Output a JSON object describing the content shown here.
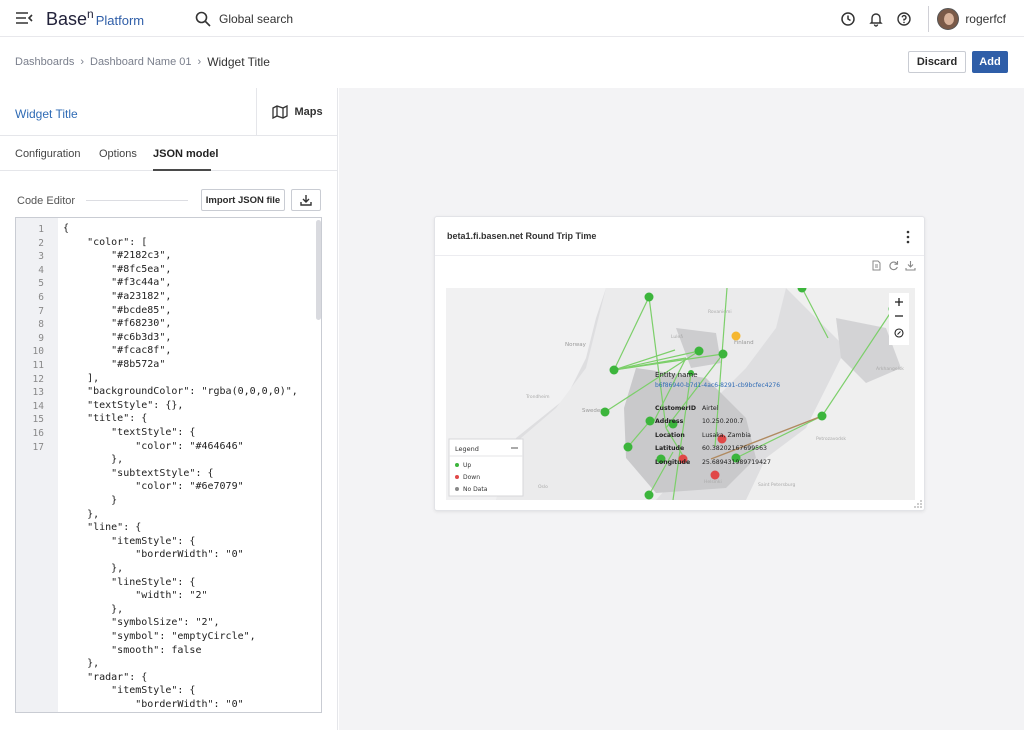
{
  "app": {
    "brand": "Base",
    "brand_sup": "n",
    "brand_platform": "Platform"
  },
  "search": {
    "label": "Global search"
  },
  "user": {
    "name": "rogerfcf"
  },
  "breadcrumb": {
    "items": [
      "Dashboards",
      "Dashboard Name 01"
    ],
    "current": "Widget Title"
  },
  "actions": {
    "discard": "Discard",
    "add": "Add"
  },
  "widget": {
    "title": "Widget Title",
    "type_label": "Maps"
  },
  "tabs": [
    "Configuration",
    "Options",
    "JSON model"
  ],
  "active_tab": "JSON model",
  "editor": {
    "label": "Code Editor",
    "import_label": "Import JSON file",
    "line_numbers": [
      "1",
      "2",
      "3",
      "4",
      "5",
      "6",
      "7",
      "8",
      "9",
      "10",
      "11",
      "12",
      "13",
      "14",
      "15",
      "16",
      "17"
    ],
    "lines": [
      "{",
      "    \"color\": [",
      "        \"#2182c3\",",
      "        \"#8fc5ea\",",
      "        \"#f3c44a\",",
      "        \"#a23182\",",
      "        \"#bcde85\",",
      "        \"#f68230\",",
      "        \"#c6b3d3\",",
      "        \"#fcac8f\",",
      "        \"#8b572a\"",
      "    ],",
      "    \"backgroundColor\": \"rgba(0,0,0,0)\",",
      "    \"textStyle\": {},",
      "    \"title\": {",
      "        \"textStyle\": {",
      "            \"color\": \"#464646\"",
      "        },",
      "        \"subtextStyle\": {",
      "            \"color\": \"#6e7079\"",
      "        }",
      "    },",
      "    \"line\": {",
      "        \"itemStyle\": {",
      "            \"borderWidth\": \"0\"",
      "        },",
      "        \"lineStyle\": {",
      "            \"width\": \"2\"",
      "        },",
      "        \"symbolSize\": \"2\",",
      "        \"symbol\": \"emptyCircle\",",
      "        \"smooth\": false",
      "    },",
      "    \"radar\": {",
      "        \"itemStyle\": {",
      "            \"borderWidth\": \"0\""
    ]
  },
  "card": {
    "title": "beta1.fi.basen.net Round Trip Time"
  },
  "map": {
    "places": [
      "Norway",
      "Finland",
      "Sweden",
      "Rovaniemi",
      "Trondheim",
      "Oslo",
      "Helsinki",
      "Saint Petersburg",
      "Arkhangelsk",
      "Petrozavodsk",
      "Luleå"
    ],
    "tooltip": {
      "entity_label": "Entity name",
      "entity_id": "b6f86940-b7d1-4ac6-8291-cb9bcfec4276",
      "rows": [
        {
          "key": "CustomerID",
          "value": "Airtel"
        },
        {
          "key": "Address",
          "value": "10.250.200.7"
        },
        {
          "key": "Location",
          "value": "Lusaka, Zambia"
        },
        {
          "key": "Latitude",
          "value": "60.38202167699563"
        },
        {
          "key": "Longitude",
          "value": "25.689431989719427"
        }
      ]
    },
    "legend": {
      "title": "Legend",
      "items": [
        {
          "label": "Up",
          "color": "#3cb53c"
        },
        {
          "label": "Down",
          "color": "#e04848"
        },
        {
          "label": "No Data",
          "color": "#8a8a8a"
        }
      ]
    },
    "colors": {
      "up": "#3cb53c",
      "down": "#e04848",
      "warn": "#f5b731",
      "link": "#7ccf6a",
      "brown": "#b08a60"
    }
  }
}
